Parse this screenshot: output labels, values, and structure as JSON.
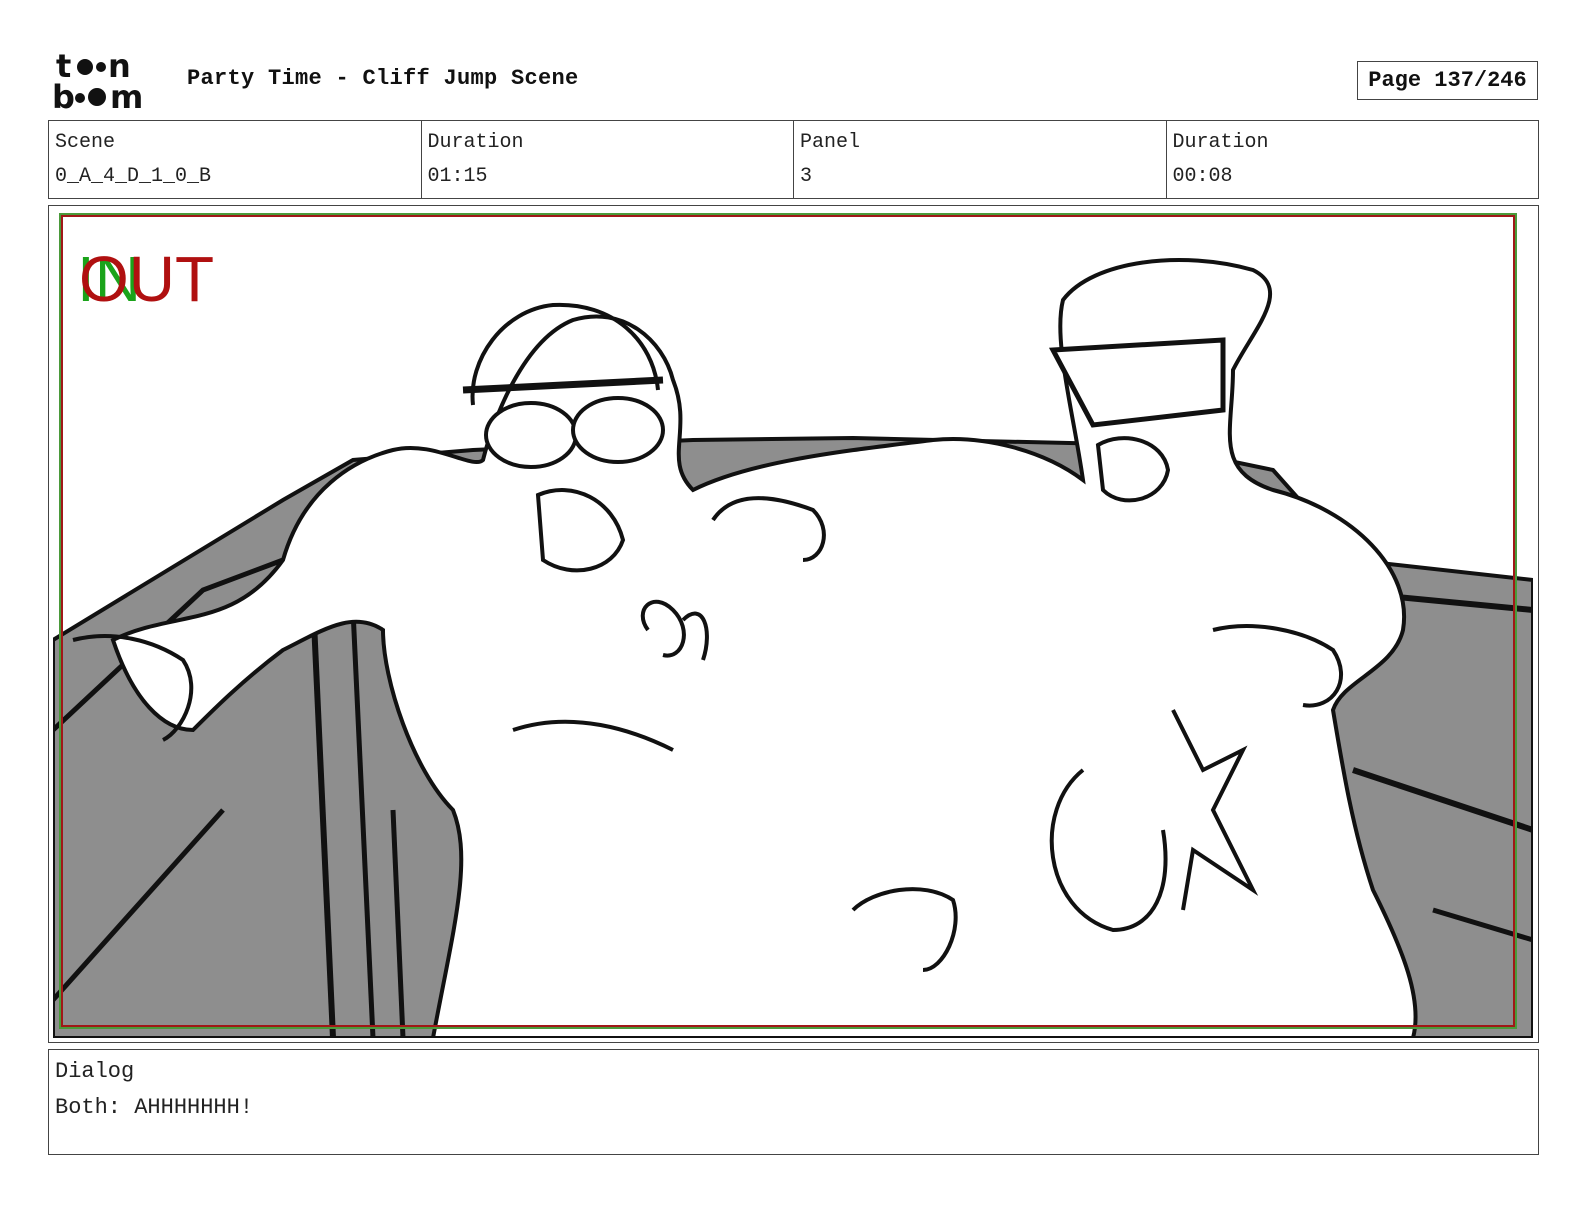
{
  "header": {
    "logo_text": "toon boom",
    "title": "Party Time - Cliff Jump Scene",
    "page_label": "Page 137/246"
  },
  "info": {
    "scene_label": "Scene",
    "scene_value": "0_A_4_D_1_0_B",
    "scene_duration_label": "Duration",
    "scene_duration_value": "01:15",
    "panel_label": "Panel",
    "panel_value": "3",
    "panel_duration_label": "Duration",
    "panel_duration_value": "00:08"
  },
  "panel": {
    "in_marker": "IN",
    "out_marker": "OUT",
    "in_color": "#1aa31a",
    "out_color": "#b01010"
  },
  "dialog": {
    "label": "Dialog",
    "text": "Both: AHHHHHHH!"
  }
}
